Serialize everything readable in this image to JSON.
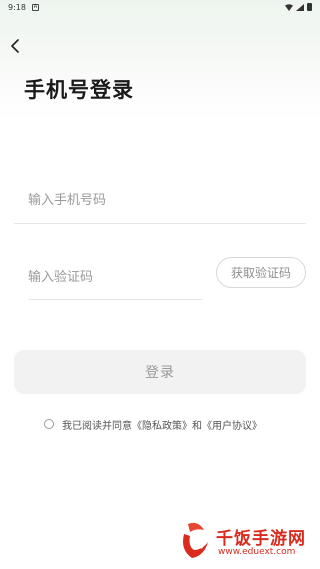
{
  "status_bar": {
    "time": "9:18",
    "notification_icon": "notification-icon",
    "wifi_icon": "wifi-icon",
    "signal_icon": "signal-icon",
    "battery_icon": "battery-icon"
  },
  "header": {
    "back_icon": "chevron-left-icon",
    "title": "手机号登录"
  },
  "form": {
    "phone_placeholder": "输入手机号码",
    "phone_value": "",
    "code_placeholder": "输入验证码",
    "code_value": "",
    "get_code_label": "获取验证码",
    "login_label": "登录"
  },
  "agreement": {
    "checked": false,
    "prefix": "我已阅读并同意",
    "privacy_link": "《隐私政策》",
    "conjunction": "和",
    "user_agreement_link": "《用户协议》"
  },
  "watermark": {
    "logo_text": "饭",
    "site_name": "千饭手游网",
    "url": "www.eduext.com"
  },
  "colors": {
    "title": "#1a1a1a",
    "placeholder": "#9a9a9a",
    "login_button_bg": "#f2f2f2",
    "watermark": "#d92c1f"
  }
}
